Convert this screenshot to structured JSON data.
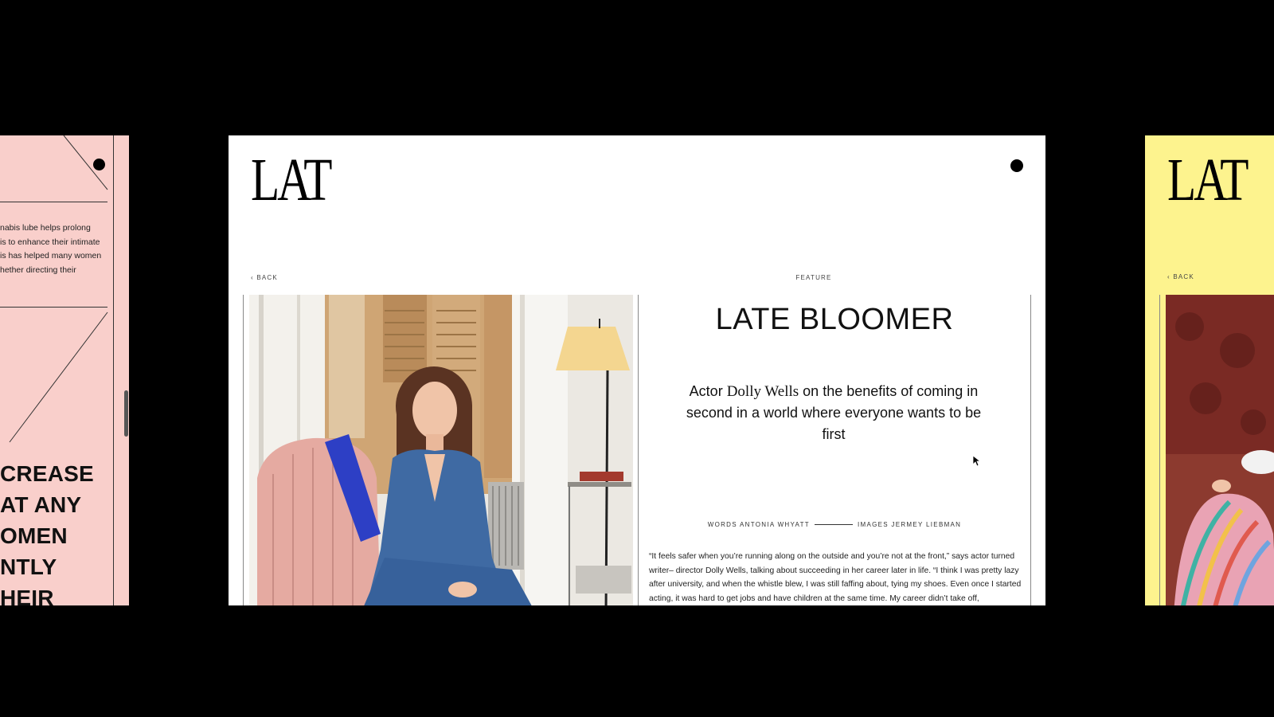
{
  "brand": {
    "logo": "LAT"
  },
  "left_card": {
    "excerpt_lines": [
      "nabis lube helps prolong",
      "is to enhance their intimate",
      "is has helped many women",
      "hether directing their"
    ],
    "headline_lines": [
      "CREASE",
      "AT ANY",
      "OMEN",
      "NTLY",
      "HEIR"
    ]
  },
  "article": {
    "back_label": "BACK",
    "section": "FEATURE",
    "title": "LATE BLOOMER",
    "deck_pre": "Actor ",
    "deck_name": "Dolly Wells",
    "deck_post": " on the benefits of coming in second in a world where everyone wants to be first",
    "words_credit": "WORDS ANTONIA WHYATT",
    "images_credit": "IMAGES JERMEY LIEBMAN",
    "body": "“It feels safer when you’re running along on the outside and you’re not at the front,” says actor turned writer– director Dolly Wells, talking about succeeding in her career later in life. “I think I was pretty lazy after university, and when the whistle blew, I was still faffing about, tying my shoes. Even once I started acting, it was hard to get jobs and have children at the same time. My career didn’t take off,"
  },
  "right_card": {
    "logo": "LAT",
    "back_label": "BACK"
  },
  "colors": {
    "background": "#000000",
    "left_card": "#f9cfcb",
    "center_card": "#ffffff",
    "right_card": "#fdf38e"
  },
  "icons": [
    "menu-dot-icon",
    "chevron-left-icon",
    "mouse-cursor-icon"
  ]
}
